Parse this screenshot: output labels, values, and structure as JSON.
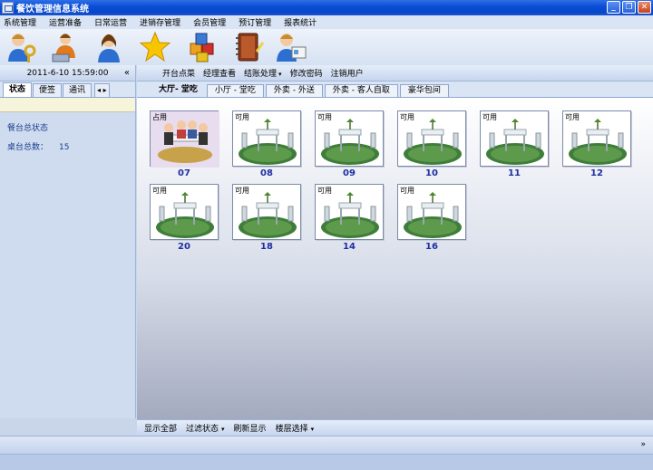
{
  "window": {
    "title": "餐饮管理信息系统"
  },
  "menu": [
    "系统管理",
    "运营准备",
    "日常运营",
    "进销存管理",
    "会员管理",
    "预订管理",
    "报表统计"
  ],
  "toolbar_icons": [
    "user-key-icon",
    "user-laptop-icon",
    "person-icon",
    "star-icon",
    "cubes-icon",
    "notebook-icon",
    "user-card-icon"
  ],
  "left": {
    "datetime": "2011-6-10  15:59:00",
    "collapse": "«",
    "tabs": [
      "状态",
      "便签",
      "通讯"
    ],
    "tab_arrows": "◂ ▸",
    "heading": "餐台总状态",
    "total_label": "桌台总数：",
    "total_value": "15"
  },
  "main_tools": [
    {
      "label": "开台点菜"
    },
    {
      "label": "经理查看"
    },
    {
      "label": "结账处理",
      "caret": "▾"
    },
    {
      "label": "修改密码"
    },
    {
      "label": "注销用户"
    }
  ],
  "room_tabs": [
    "大厅- 堂吃",
    "小厅 - 堂吃",
    "外卖 - 外送",
    "外卖 - 客人自取",
    "豪华包间"
  ],
  "tables": [
    {
      "number": "07",
      "status": "占用",
      "occupied": true
    },
    {
      "number": "08",
      "status": "可用",
      "occupied": false
    },
    {
      "number": "09",
      "status": "可用",
      "occupied": false
    },
    {
      "number": "10",
      "status": "可用",
      "occupied": false
    },
    {
      "number": "11",
      "status": "可用",
      "occupied": false
    },
    {
      "number": "12",
      "status": "可用",
      "occupied": false
    },
    {
      "number": "20",
      "status": "可用",
      "occupied": false
    },
    {
      "number": "18",
      "status": "可用",
      "occupied": false
    },
    {
      "number": "14",
      "status": "可用",
      "occupied": false
    },
    {
      "number": "16",
      "status": "可用",
      "occupied": false
    }
  ],
  "bottom_tools": [
    {
      "label": "显示全部"
    },
    {
      "label": "过滤状态",
      "caret": "▾"
    },
    {
      "label": "刷新显示"
    },
    {
      "label": "楼层选择",
      "caret": "▾"
    }
  ],
  "statusbar": {
    "expand": "»"
  }
}
